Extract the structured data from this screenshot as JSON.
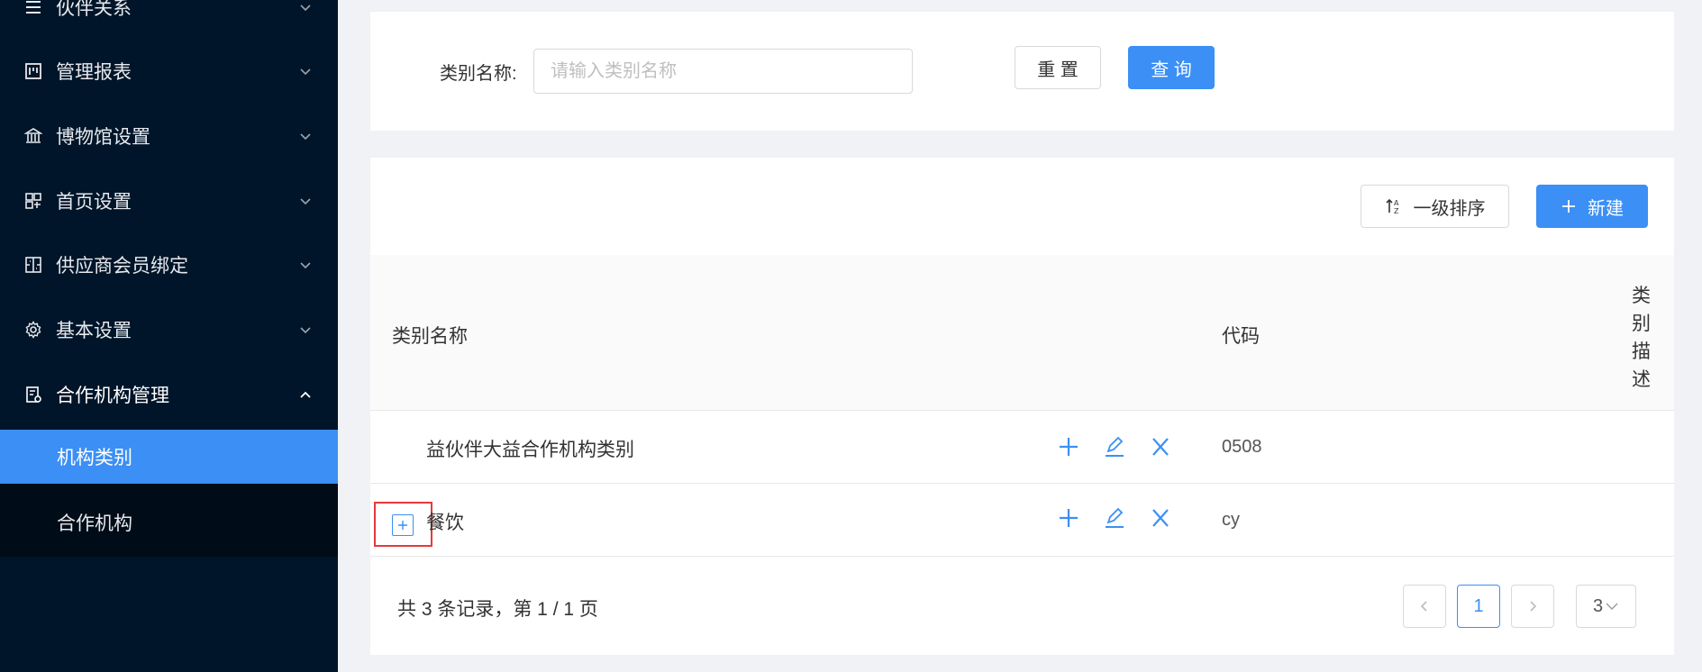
{
  "sidebar": {
    "items": [
      {
        "label": "伙伴关系",
        "icon": "menu-lines-icon"
      },
      {
        "label": "管理报表",
        "icon": "report-icon"
      },
      {
        "label": "博物馆设置",
        "icon": "museum-icon"
      },
      {
        "label": "首页设置",
        "icon": "home-layout-icon"
      },
      {
        "label": "供应商会员绑定",
        "icon": "supplier-icon"
      },
      {
        "label": "基本设置",
        "icon": "gear-icon"
      },
      {
        "label": "合作机构管理",
        "icon": "org-manage-icon"
      }
    ],
    "subitems": [
      {
        "label": "机构类别",
        "active": true
      },
      {
        "label": "合作机构",
        "active": false
      }
    ]
  },
  "search": {
    "label": "类别名称:",
    "placeholder": "请输入类别名称",
    "value": "",
    "reset_label": "重 置",
    "query_label": "查 询"
  },
  "toolbar": {
    "sort_label": "一级排序",
    "new_label": "新建"
  },
  "table": {
    "columns": {
      "name": "类别名称",
      "code": "代码",
      "desc": "类别描述"
    },
    "rows": [
      {
        "name": "益伙伴大益合作机构类别",
        "code": "0508",
        "desc": ""
      },
      {
        "name": "餐饮",
        "code": "cy",
        "desc": ""
      }
    ]
  },
  "pagination": {
    "info": "共 3 条记录，第 1 / 1 页",
    "current": "1",
    "page_size": "3"
  },
  "colors": {
    "sidebar_bg": "#001529",
    "accent": "#3b8ff5",
    "highlight_border": "#e6393b"
  }
}
